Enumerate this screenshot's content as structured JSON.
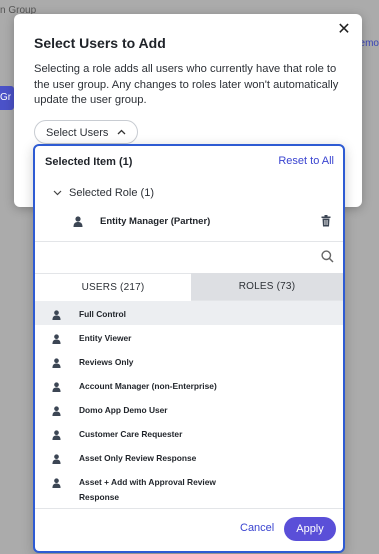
{
  "background": {
    "crumb": "n Group",
    "right_link": "Remo",
    "left_chip": "Gr"
  },
  "modal": {
    "title": "Select Users to Add",
    "close_icon": "close-icon",
    "description": "Selecting a role adds all users who currently have that role to the user group. Any changes to roles later won't automatically update the user group.",
    "select_button_label": "Select Users"
  },
  "dropdown": {
    "selected_header": "Selected Item (1)",
    "reset_all": "Reset to All",
    "selected_role_group": "Selected Role (1)",
    "selected_roles": [
      {
        "name": "Entity Manager (Partner)"
      }
    ],
    "search": {
      "placeholder": "",
      "value": ""
    },
    "tabs": [
      {
        "label": "USERS (217)",
        "active": false
      },
      {
        "label": "ROLES (73)",
        "active": true
      }
    ],
    "roles": [
      {
        "label": "Full Control"
      },
      {
        "label": "Entity Viewer"
      },
      {
        "label": "Reviews Only"
      },
      {
        "label": "Account Manager (non-Enterprise)"
      },
      {
        "label": "Domo App Demo User"
      },
      {
        "label": "Customer Care Requester"
      },
      {
        "label": "Asset Only Review Response"
      },
      {
        "label": "Asset + Add with Approval Review Response"
      }
    ],
    "cancel_label": "Cancel",
    "apply_label": "Apply"
  },
  "colors": {
    "accent": "#2e5bd3",
    "primary_button": "#5a4fd8",
    "link": "#3a44d0"
  }
}
